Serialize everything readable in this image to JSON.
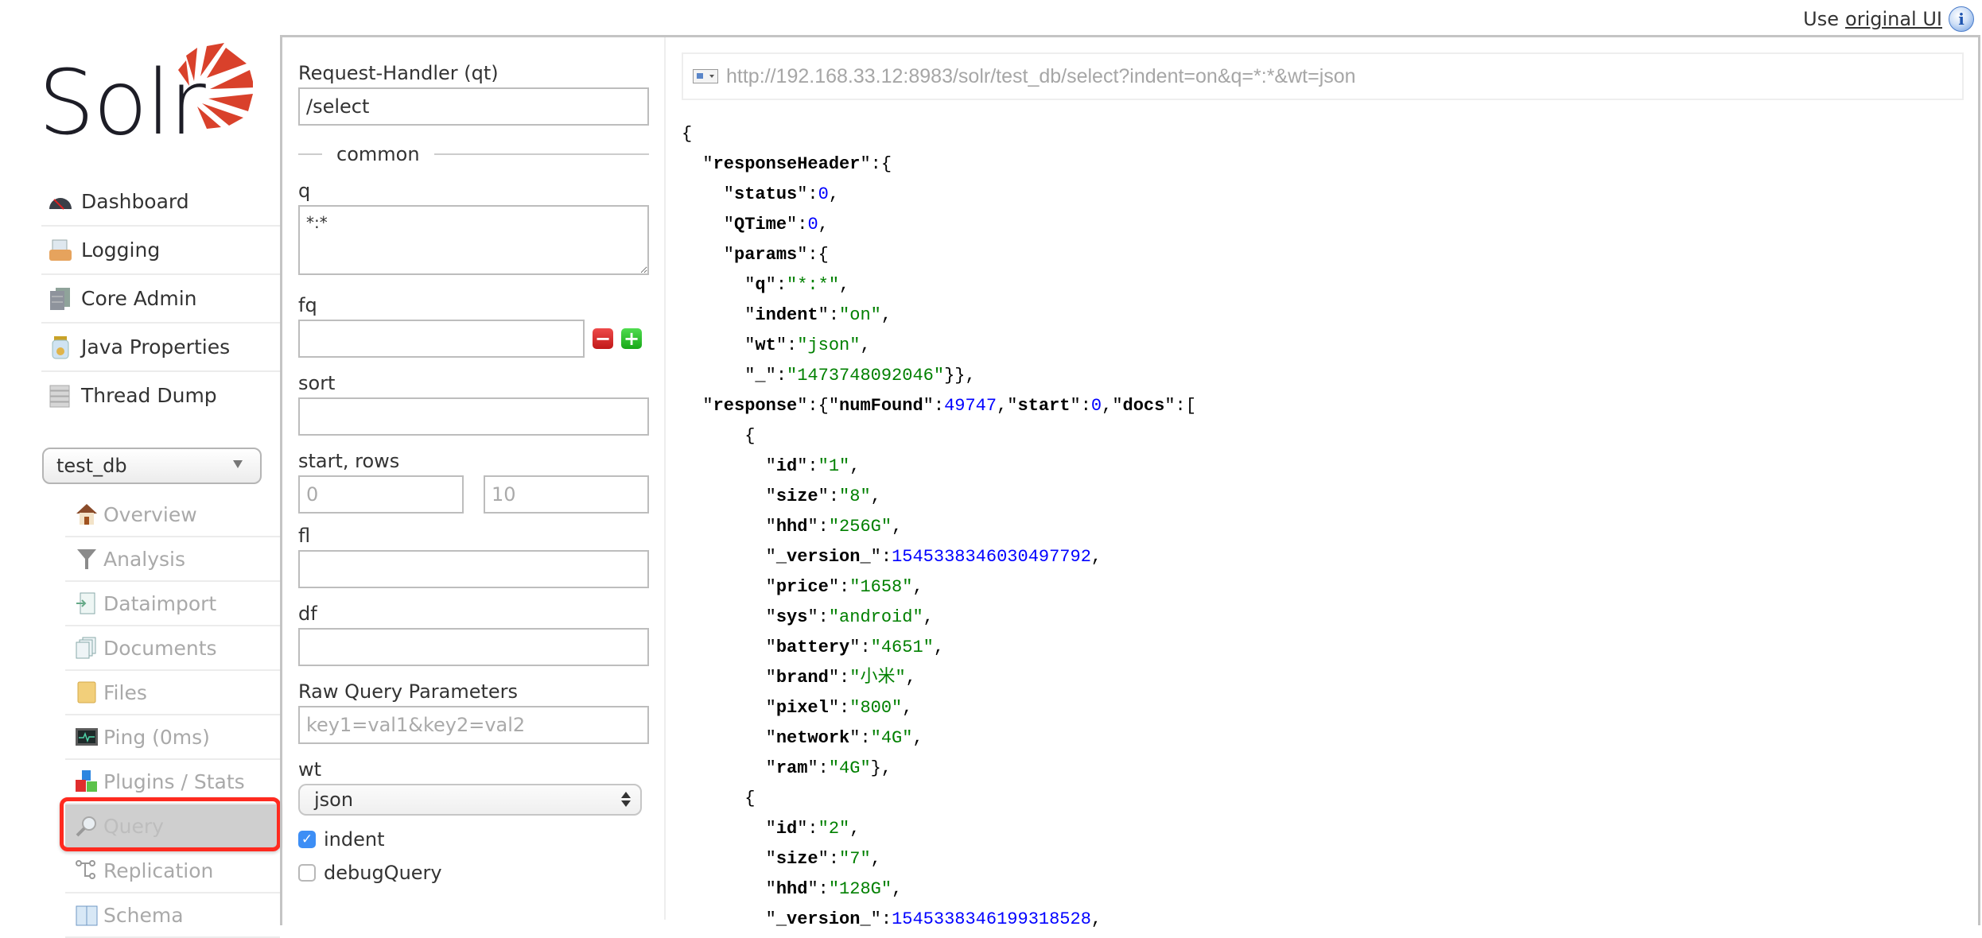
{
  "topbar": {
    "prefix": "Use",
    "link": "original UI",
    "info_icon": "info-icon"
  },
  "logo": {
    "text": "Solr",
    "accent": "#d9412b"
  },
  "nav": {
    "items": [
      {
        "label": "Dashboard",
        "icon": "dashboard-gauge-icon"
      },
      {
        "label": "Logging",
        "icon": "logging-tray-icon"
      },
      {
        "label": "Core Admin",
        "icon": "core-admin-servers-icon"
      },
      {
        "label": "Java Properties",
        "icon": "java-jar-icon"
      },
      {
        "label": "Thread Dump",
        "icon": "thread-dump-stack-icon"
      }
    ]
  },
  "core_selector": {
    "value": "test_db"
  },
  "core_nav": {
    "items": [
      {
        "label": "Overview",
        "icon": "house-icon"
      },
      {
        "label": "Analysis",
        "icon": "funnel-icon"
      },
      {
        "label": "Dataimport",
        "icon": "import-document-icon"
      },
      {
        "label": "Documents",
        "icon": "documents-icon"
      },
      {
        "label": "Files",
        "icon": "folder-icon"
      },
      {
        "label": "Ping (0ms)",
        "icon": "monitor-pulse-icon"
      },
      {
        "label": "Plugins / Stats",
        "icon": "blocks-icon"
      },
      {
        "label": "Query",
        "icon": "magnifier-icon",
        "active": true
      },
      {
        "label": "Replication",
        "icon": "replication-nodes-icon"
      },
      {
        "label": "Schema",
        "icon": "schema-book-icon"
      }
    ],
    "highlight_color": "#ff2a1f"
  },
  "form": {
    "qt_label": "Request-Handler (qt)",
    "qt_value": "/select",
    "section_common": "common",
    "q_label": "q",
    "q_value": "*:*",
    "fq_label": "fq",
    "fq_value": "",
    "sort_label": "sort",
    "sort_value": "",
    "start_rows_label": "start, rows",
    "start_placeholder": "0",
    "rows_placeholder": "10",
    "fl_label": "fl",
    "fl_value": "",
    "df_label": "df",
    "df_value": "",
    "raw_label": "Raw Query Parameters",
    "raw_placeholder": "key1=val1&key2=val2",
    "wt_label": "wt",
    "wt_value": "json",
    "indent_label": "indent",
    "indent_checked": true,
    "debug_label": "debugQuery",
    "debug_checked": false
  },
  "results": {
    "url": "http://192.168.33.12:8983/solr/test_db/select?indent=on&q=*:*&wt=json",
    "lines": [
      [
        [
          "p",
          "{"
        ]
      ],
      [
        [
          "p",
          "  \""
        ],
        [
          "k",
          "responseHeader"
        ],
        [
          "p",
          "\":{"
        ]
      ],
      [
        [
          "p",
          "    \""
        ],
        [
          "k",
          "status"
        ],
        [
          "p",
          "\":"
        ],
        [
          "n",
          "0"
        ],
        [
          "p",
          ","
        ]
      ],
      [
        [
          "p",
          "    \""
        ],
        [
          "k",
          "QTime"
        ],
        [
          "p",
          "\":"
        ],
        [
          "n",
          "0"
        ],
        [
          "p",
          ","
        ]
      ],
      [
        [
          "p",
          "    \""
        ],
        [
          "k",
          "params"
        ],
        [
          "p",
          "\":{"
        ]
      ],
      [
        [
          "p",
          "      \""
        ],
        [
          "k",
          "q"
        ],
        [
          "p",
          "\":"
        ],
        [
          "s",
          "\"*:*\""
        ],
        [
          "p",
          ","
        ]
      ],
      [
        [
          "p",
          "      \""
        ],
        [
          "k",
          "indent"
        ],
        [
          "p",
          "\":"
        ],
        [
          "s",
          "\"on\""
        ],
        [
          "p",
          ","
        ]
      ],
      [
        [
          "p",
          "      \""
        ],
        [
          "k",
          "wt"
        ],
        [
          "p",
          "\":"
        ],
        [
          "s",
          "\"json\""
        ],
        [
          "p",
          ","
        ]
      ],
      [
        [
          "p",
          "      \""
        ],
        [
          "k",
          "_"
        ],
        [
          "p",
          "\":"
        ],
        [
          "s",
          "\"1473748092046\""
        ],
        [
          "p",
          "}},"
        ]
      ],
      [
        [
          "p",
          "  \""
        ],
        [
          "k",
          "response"
        ],
        [
          "p",
          "\":{\""
        ],
        [
          "k",
          "numFound"
        ],
        [
          "p",
          "\":"
        ],
        [
          "n",
          "49747"
        ],
        [
          "p",
          ",\""
        ],
        [
          "k",
          "start"
        ],
        [
          "p",
          "\":"
        ],
        [
          "n",
          "0"
        ],
        [
          "p",
          ",\""
        ],
        [
          "k",
          "docs"
        ],
        [
          "p",
          "\":["
        ]
      ],
      [
        [
          "p",
          "      {"
        ]
      ],
      [
        [
          "p",
          "        \""
        ],
        [
          "k",
          "id"
        ],
        [
          "p",
          "\":"
        ],
        [
          "s",
          "\"1\""
        ],
        [
          "p",
          ","
        ]
      ],
      [
        [
          "p",
          "        \""
        ],
        [
          "k",
          "size"
        ],
        [
          "p",
          "\":"
        ],
        [
          "s",
          "\"8\""
        ],
        [
          "p",
          ","
        ]
      ],
      [
        [
          "p",
          "        \""
        ],
        [
          "k",
          "hhd"
        ],
        [
          "p",
          "\":"
        ],
        [
          "s",
          "\"256G\""
        ],
        [
          "p",
          ","
        ]
      ],
      [
        [
          "p",
          "        \""
        ],
        [
          "k",
          "_version_"
        ],
        [
          "p",
          "\":"
        ],
        [
          "n",
          "1545338346030497792"
        ],
        [
          "p",
          ","
        ]
      ],
      [
        [
          "p",
          "        \""
        ],
        [
          "k",
          "price"
        ],
        [
          "p",
          "\":"
        ],
        [
          "s",
          "\"1658\""
        ],
        [
          "p",
          ","
        ]
      ],
      [
        [
          "p",
          "        \""
        ],
        [
          "k",
          "sys"
        ],
        [
          "p",
          "\":"
        ],
        [
          "s",
          "\"android\""
        ],
        [
          "p",
          ","
        ]
      ],
      [
        [
          "p",
          "        \""
        ],
        [
          "k",
          "battery"
        ],
        [
          "p",
          "\":"
        ],
        [
          "s",
          "\"4651\""
        ],
        [
          "p",
          ","
        ]
      ],
      [
        [
          "p",
          "        \""
        ],
        [
          "k",
          "brand"
        ],
        [
          "p",
          "\":"
        ],
        [
          "s",
          "\"小米\""
        ],
        [
          "p",
          ","
        ]
      ],
      [
        [
          "p",
          "        \""
        ],
        [
          "k",
          "pixel"
        ],
        [
          "p",
          "\":"
        ],
        [
          "s",
          "\"800\""
        ],
        [
          "p",
          ","
        ]
      ],
      [
        [
          "p",
          "        \""
        ],
        [
          "k",
          "network"
        ],
        [
          "p",
          "\":"
        ],
        [
          "s",
          "\"4G\""
        ],
        [
          "p",
          ","
        ]
      ],
      [
        [
          "p",
          "        \""
        ],
        [
          "k",
          "ram"
        ],
        [
          "p",
          "\":"
        ],
        [
          "s",
          "\"4G\""
        ],
        [
          "p",
          "},"
        ]
      ],
      [
        [
          "p",
          "      {"
        ]
      ],
      [
        [
          "p",
          "        \""
        ],
        [
          "k",
          "id"
        ],
        [
          "p",
          "\":"
        ],
        [
          "s",
          "\"2\""
        ],
        [
          "p",
          ","
        ]
      ],
      [
        [
          "p",
          "        \""
        ],
        [
          "k",
          "size"
        ],
        [
          "p",
          "\":"
        ],
        [
          "s",
          "\"7\""
        ],
        [
          "p",
          ","
        ]
      ],
      [
        [
          "p",
          "        \""
        ],
        [
          "k",
          "hhd"
        ],
        [
          "p",
          "\":"
        ],
        [
          "s",
          "\"128G\""
        ],
        [
          "p",
          ","
        ]
      ],
      [
        [
          "p",
          "        \""
        ],
        [
          "k",
          "_version_"
        ],
        [
          "p",
          "\":"
        ],
        [
          "n",
          "1545338346199318528"
        ],
        [
          "p",
          ","
        ]
      ]
    ],
    "colors": {
      "string": "#008000",
      "number": "#0000ff",
      "key": "#000000"
    }
  }
}
